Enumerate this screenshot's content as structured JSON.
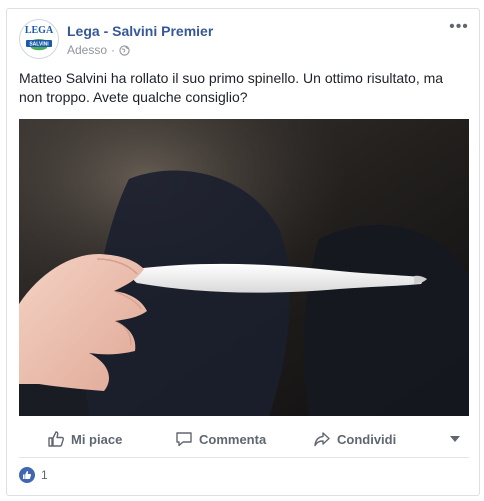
{
  "post": {
    "page_name": "Lega - Salvini Premier",
    "timestamp": "Adesso",
    "privacy_icon": "globe-icon",
    "menu_icon": "more-options-icon",
    "text": "Matteo Salvini ha rollato il suo primo spinello. Un ottimo risultato, ma non troppo. Avete qualche consiglio?",
    "avatar": {
      "top_text": "LEGA",
      "banner_text": "SALVINI",
      "brand_color": "#1b5aa8",
      "accent_color": "#2f9f3a"
    }
  },
  "actions": {
    "like_label": "Mi piace",
    "comment_label": "Commenta",
    "share_label": "Condividi",
    "like_icon": "thumbs-up-icon",
    "comment_icon": "comment-bubble-icon",
    "share_icon": "share-arrow-icon",
    "menu_icon": "chevron-down-icon"
  },
  "reactions": {
    "count": "1",
    "icon": "like-badge-icon",
    "color": "#4267b2"
  },
  "colors": {
    "link": "#365899",
    "meta": "#90949c",
    "action_text": "#606770"
  }
}
